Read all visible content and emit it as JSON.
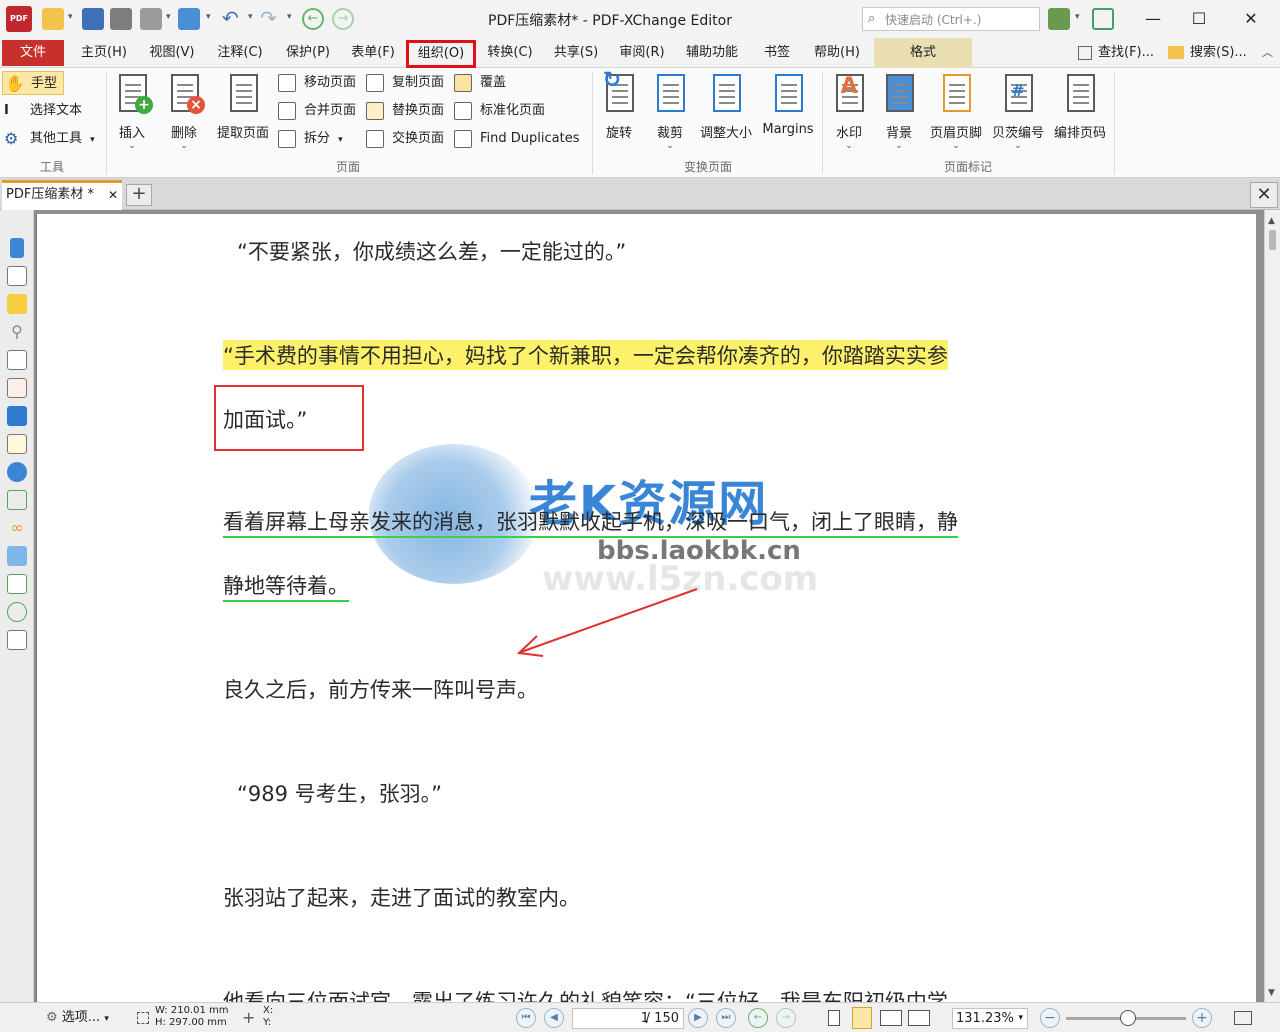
{
  "window": {
    "title": "PDF压缩素材* - PDF-XChange Editor",
    "quick_launch_placeholder": "快速启动 (Ctrl+.)",
    "minimize": "—",
    "maximize": "☐",
    "close": "✕"
  },
  "menu": {
    "file": "文件",
    "home": "主页(H)",
    "view": "视图(V)",
    "comment": "注释(C)",
    "protect": "保护(P)",
    "form": "表单(F)",
    "organize": "组织(O)",
    "convert": "转换(C)",
    "share": "共享(S)",
    "review": "审阅(R)",
    "accessibility": "辅助功能",
    "bookmarks": "书签",
    "help": "帮助(H)",
    "format": "格式",
    "find": "查找(F)...",
    "search": "搜索(S)..."
  },
  "ribbon": {
    "tools_group": {
      "label": "工具",
      "hand": "手型",
      "select_text": "选择文本",
      "other_tools": "其他工具"
    },
    "pages_group": {
      "label": "页面",
      "insert": "插入",
      "delete": "删除",
      "extract": "提取页面",
      "move": "移动页面",
      "merge": "合并页面",
      "split": "拆分",
      "duplicate": "复制页面",
      "replace": "替换页面",
      "swap": "交换页面",
      "overlay": "覆盖",
      "normalize": "标准化页面",
      "find_duplicates": "Find Duplicates"
    },
    "transform_group": {
      "label": "变换页面",
      "rotate": "旋转",
      "crop": "裁剪",
      "resize": "调整大小",
      "margins": "Margins"
    },
    "marks_group": {
      "label": "页面标记",
      "watermark": "水印",
      "background": "背景",
      "header_footer": "页眉页脚",
      "bates": "贝茨编号",
      "numbering": "编排页码"
    }
  },
  "doc_tab": {
    "name": "PDF压缩素材 *",
    "close": "✕",
    "new_tab": "+",
    "close_doc": "✕"
  },
  "document": {
    "lines": [
      "“不要紧张，你成绩这么差，一定能过的。”",
      "“手术费的事情不用担心，妈找了个新兼职，一定会帮你凑齐的，你踏踏实实参",
      "加面试。”",
      "看着屏幕上母亲发来的消息，张羽默默收起手机，深吸一口气，闭上了眼睛，静",
      "静地等待着。",
      "良久之后，前方传来一阵叫号声。",
      "“989 号考生，张羽。”",
      "张羽站了起来，走进了面试的教室内。",
      "他看向三位面试官，露出了练习许久的礼貌笑容：“三位好，我是东阳初级中学"
    ],
    "watermark": {
      "brand": "老K资源网",
      "url": "bbs.laokbk.cn",
      "url_faint": "www.l5zn.com"
    }
  },
  "status": {
    "options": "选项...",
    "width": "W: 210.01 mm",
    "height": "H: 297.00 mm",
    "x": "X:",
    "y": "Y:",
    "page_current": "1",
    "page_total": "/ 150",
    "zoom": "131.23%"
  },
  "colors": {
    "accent_red": "#c8302c",
    "highlight_yellow": "#fdf06b",
    "underline_green": "#39d14a",
    "annotation_red": "#e03030"
  }
}
